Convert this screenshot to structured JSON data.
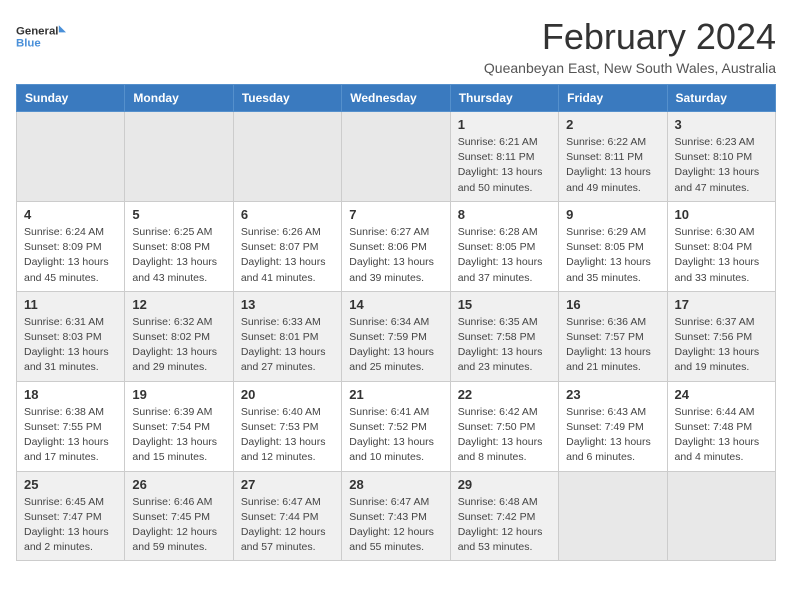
{
  "logo": {
    "line1": "General",
    "line2": "Blue"
  },
  "title": "February 2024",
  "subtitle": "Queanbeyan East, New South Wales, Australia",
  "days_of_week": [
    "Sunday",
    "Monday",
    "Tuesday",
    "Wednesday",
    "Thursday",
    "Friday",
    "Saturday"
  ],
  "weeks": [
    [
      {
        "day": "",
        "info": ""
      },
      {
        "day": "",
        "info": ""
      },
      {
        "day": "",
        "info": ""
      },
      {
        "day": "",
        "info": ""
      },
      {
        "day": "1",
        "info": "Sunrise: 6:21 AM\nSunset: 8:11 PM\nDaylight: 13 hours\nand 50 minutes."
      },
      {
        "day": "2",
        "info": "Sunrise: 6:22 AM\nSunset: 8:11 PM\nDaylight: 13 hours\nand 49 minutes."
      },
      {
        "day": "3",
        "info": "Sunrise: 6:23 AM\nSunset: 8:10 PM\nDaylight: 13 hours\nand 47 minutes."
      }
    ],
    [
      {
        "day": "4",
        "info": "Sunrise: 6:24 AM\nSunset: 8:09 PM\nDaylight: 13 hours\nand 45 minutes."
      },
      {
        "day": "5",
        "info": "Sunrise: 6:25 AM\nSunset: 8:08 PM\nDaylight: 13 hours\nand 43 minutes."
      },
      {
        "day": "6",
        "info": "Sunrise: 6:26 AM\nSunset: 8:07 PM\nDaylight: 13 hours\nand 41 minutes."
      },
      {
        "day": "7",
        "info": "Sunrise: 6:27 AM\nSunset: 8:06 PM\nDaylight: 13 hours\nand 39 minutes."
      },
      {
        "day": "8",
        "info": "Sunrise: 6:28 AM\nSunset: 8:05 PM\nDaylight: 13 hours\nand 37 minutes."
      },
      {
        "day": "9",
        "info": "Sunrise: 6:29 AM\nSunset: 8:05 PM\nDaylight: 13 hours\nand 35 minutes."
      },
      {
        "day": "10",
        "info": "Sunrise: 6:30 AM\nSunset: 8:04 PM\nDaylight: 13 hours\nand 33 minutes."
      }
    ],
    [
      {
        "day": "11",
        "info": "Sunrise: 6:31 AM\nSunset: 8:03 PM\nDaylight: 13 hours\nand 31 minutes."
      },
      {
        "day": "12",
        "info": "Sunrise: 6:32 AM\nSunset: 8:02 PM\nDaylight: 13 hours\nand 29 minutes."
      },
      {
        "day": "13",
        "info": "Sunrise: 6:33 AM\nSunset: 8:01 PM\nDaylight: 13 hours\nand 27 minutes."
      },
      {
        "day": "14",
        "info": "Sunrise: 6:34 AM\nSunset: 7:59 PM\nDaylight: 13 hours\nand 25 minutes."
      },
      {
        "day": "15",
        "info": "Sunrise: 6:35 AM\nSunset: 7:58 PM\nDaylight: 13 hours\nand 23 minutes."
      },
      {
        "day": "16",
        "info": "Sunrise: 6:36 AM\nSunset: 7:57 PM\nDaylight: 13 hours\nand 21 minutes."
      },
      {
        "day": "17",
        "info": "Sunrise: 6:37 AM\nSunset: 7:56 PM\nDaylight: 13 hours\nand 19 minutes."
      }
    ],
    [
      {
        "day": "18",
        "info": "Sunrise: 6:38 AM\nSunset: 7:55 PM\nDaylight: 13 hours\nand 17 minutes."
      },
      {
        "day": "19",
        "info": "Sunrise: 6:39 AM\nSunset: 7:54 PM\nDaylight: 13 hours\nand 15 minutes."
      },
      {
        "day": "20",
        "info": "Sunrise: 6:40 AM\nSunset: 7:53 PM\nDaylight: 13 hours\nand 12 minutes."
      },
      {
        "day": "21",
        "info": "Sunrise: 6:41 AM\nSunset: 7:52 PM\nDaylight: 13 hours\nand 10 minutes."
      },
      {
        "day": "22",
        "info": "Sunrise: 6:42 AM\nSunset: 7:50 PM\nDaylight: 13 hours\nand 8 minutes."
      },
      {
        "day": "23",
        "info": "Sunrise: 6:43 AM\nSunset: 7:49 PM\nDaylight: 13 hours\nand 6 minutes."
      },
      {
        "day": "24",
        "info": "Sunrise: 6:44 AM\nSunset: 7:48 PM\nDaylight: 13 hours\nand 4 minutes."
      }
    ],
    [
      {
        "day": "25",
        "info": "Sunrise: 6:45 AM\nSunset: 7:47 PM\nDaylight: 13 hours\nand 2 minutes."
      },
      {
        "day": "26",
        "info": "Sunrise: 6:46 AM\nSunset: 7:45 PM\nDaylight: 12 hours\nand 59 minutes."
      },
      {
        "day": "27",
        "info": "Sunrise: 6:47 AM\nSunset: 7:44 PM\nDaylight: 12 hours\nand 57 minutes."
      },
      {
        "day": "28",
        "info": "Sunrise: 6:47 AM\nSunset: 7:43 PM\nDaylight: 12 hours\nand 55 minutes."
      },
      {
        "day": "29",
        "info": "Sunrise: 6:48 AM\nSunset: 7:42 PM\nDaylight: 12 hours\nand 53 minutes."
      },
      {
        "day": "",
        "info": ""
      },
      {
        "day": "",
        "info": ""
      }
    ]
  ]
}
